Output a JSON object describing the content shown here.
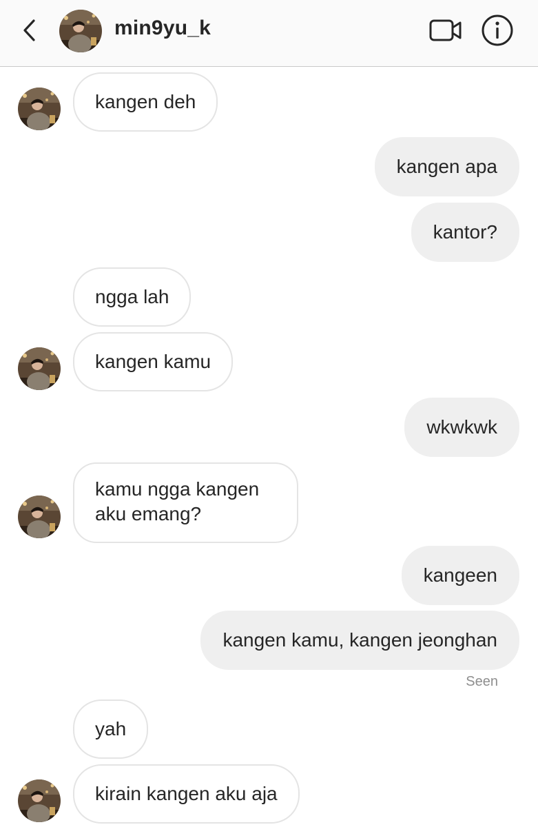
{
  "header": {
    "username": "min9yu_k",
    "back_icon": "chevron-left-icon",
    "video_icon": "video-camera-icon",
    "info_icon": "info-icon"
  },
  "messages": [
    {
      "sender": "them",
      "text": "kangen deh"
    },
    {
      "sender": "me",
      "text": "kangen apa"
    },
    {
      "sender": "me",
      "text": "kantor?"
    },
    {
      "sender": "them",
      "text": "ngga lah"
    },
    {
      "sender": "them",
      "text": "kangen kamu"
    },
    {
      "sender": "me",
      "text": "wkwkwk"
    },
    {
      "sender": "them",
      "text": "kamu ngga kangen aku emang?"
    },
    {
      "sender": "me",
      "text": "kangeen"
    },
    {
      "sender": "me",
      "text": "kangen kamu, kangen jeonghan"
    },
    {
      "sender": "them",
      "text": "yah"
    },
    {
      "sender": "them",
      "text": "kirain kangen aku aja"
    }
  ],
  "seen_label": "Seen",
  "colors": {
    "outgoing_bubble": "#efefef",
    "incoming_border": "#e4e4e4",
    "header_bg": "#fafafa",
    "seen_text": "#8e8e8e"
  }
}
